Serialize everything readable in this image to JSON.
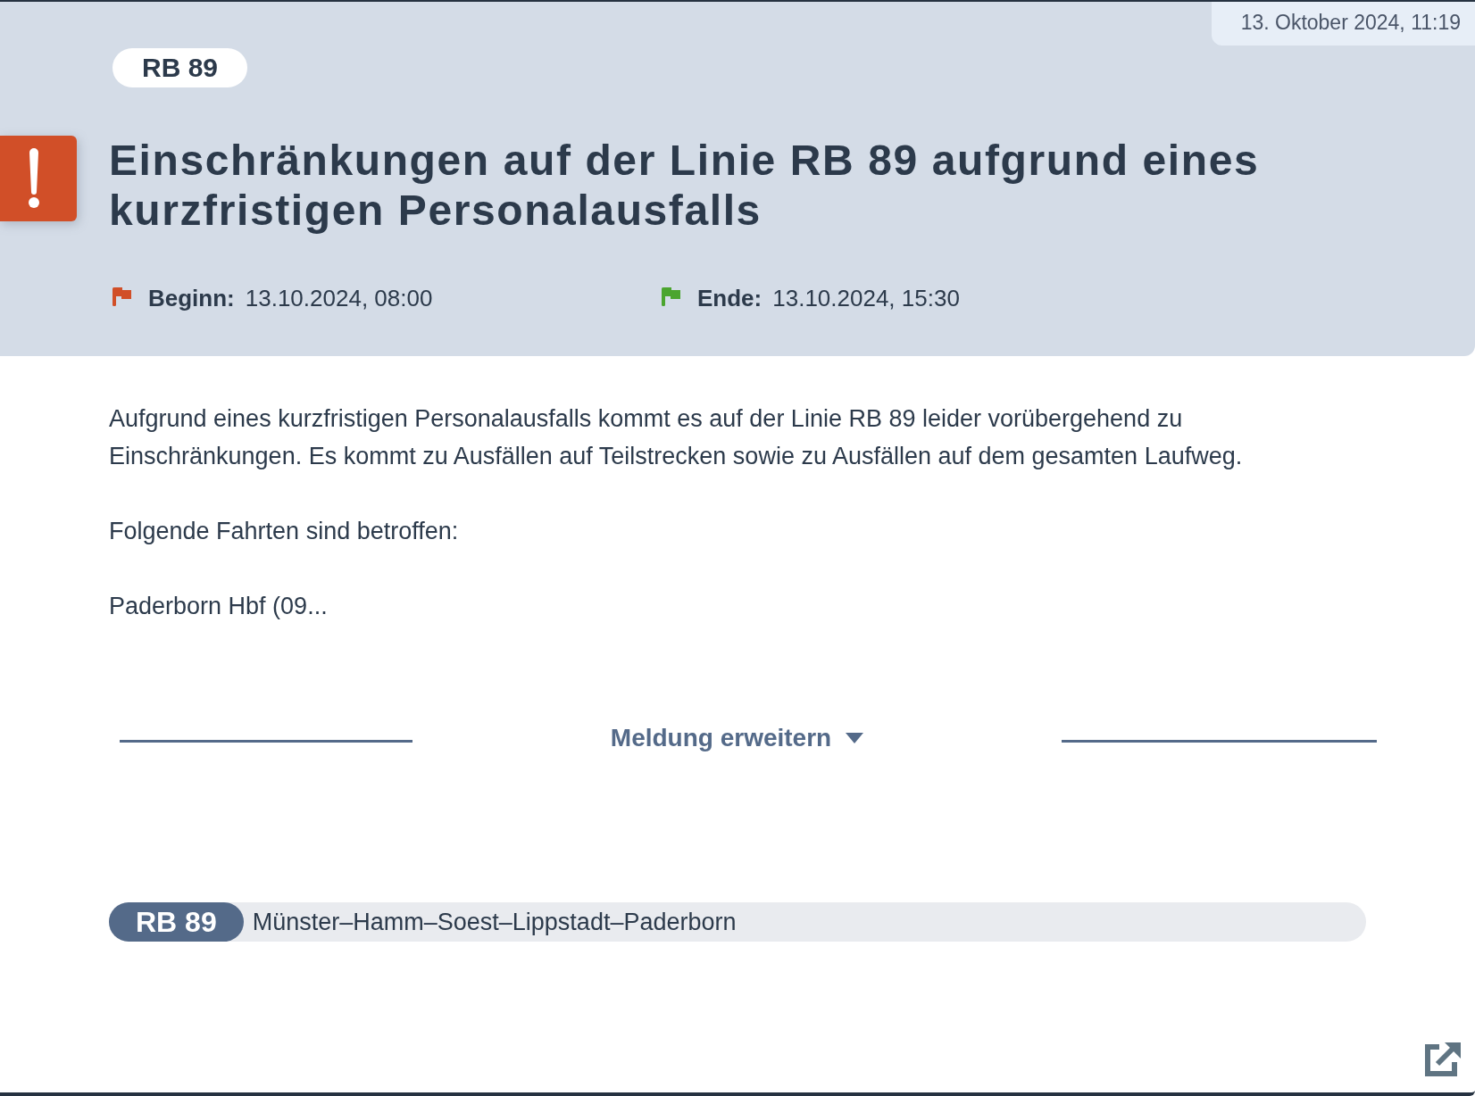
{
  "timestamp": "13. Oktober 2024, 11:19",
  "line_badge": "RB 89",
  "title": "Einschränkungen auf der Linie RB 89 aufgrund eines kurzfristigen Personalausfalls",
  "period": [
    {
      "kind": "start",
      "label": "Beginn:",
      "value": "13.10.2024, 08:00",
      "color": "#d14f28"
    },
    {
      "kind": "end",
      "label": "Ende:",
      "value": "13.10.2024, 15:30",
      "color": "#4ba52f"
    }
  ],
  "body": [
    "Aufgrund eines kurzfristigen Personalausfalls kommt es auf der Linie RB 89 leider vorübergehend zu Einschränkungen. Es kommt zu Ausfällen auf Teilstrecken sowie zu Ausfällen auf dem gesamten Laufweg.",
    "Folgende Fahrten sind betroffen:",
    "Paderborn Hbf (09..."
  ],
  "expand_button": {
    "label": "Meldung erweitern",
    "expanded": false
  },
  "route": {
    "line": "RB 89",
    "stops": "Münster–Hamm–Soest–Lippstadt–Paderborn"
  }
}
